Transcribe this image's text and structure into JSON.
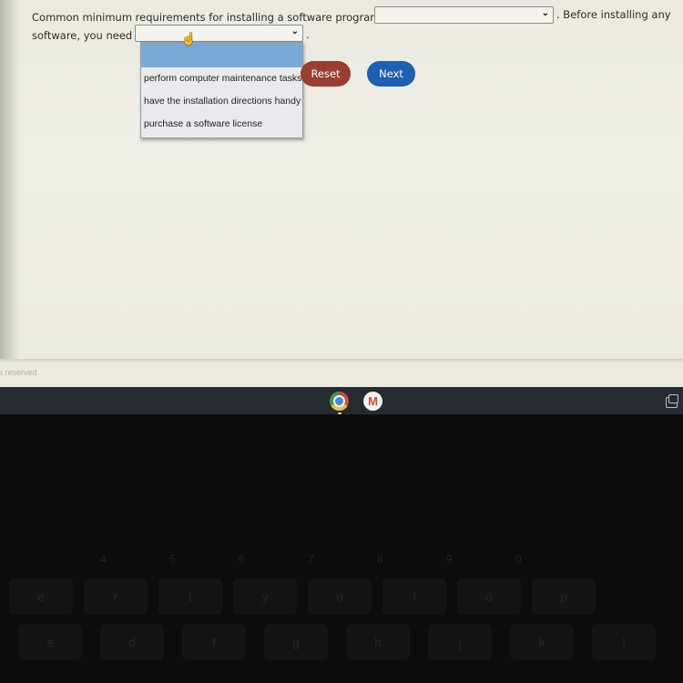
{
  "question": {
    "line1_before": "Common minimum requirements for installing a software program include",
    "line1_after": ". Before installing any",
    "line2_before": "software, you need to",
    "line2_after": "."
  },
  "select1": {
    "value": "",
    "open": false
  },
  "select2": {
    "value": "",
    "open": true,
    "options": [
      "",
      "perform computer maintenance tasks",
      "have the installation directions handy",
      "purchase a software license"
    ]
  },
  "buttons": {
    "reset_label": "Reset",
    "next_label": "Next"
  },
  "footer": {
    "text": "ts reserved."
  },
  "shelf": {
    "apps": [
      {
        "name": "chrome-icon",
        "running": true
      },
      {
        "name": "gmail-icon",
        "glyph": "M",
        "running": false
      }
    ],
    "overview_icon": "overview-icon"
  },
  "colors": {
    "reset": "#9a3e30",
    "next": "#1c5fb3",
    "dropdown_highlight": "#79a9d6",
    "shelf": "#262a31"
  },
  "keyboard": {
    "row_numbers": [
      "4",
      "5",
      "6",
      "7",
      "8",
      "9",
      "0"
    ],
    "row_top": [
      "e",
      "r",
      "t",
      "y",
      "u",
      "i",
      "o",
      "p"
    ],
    "row_home": [
      "s",
      "d",
      "f",
      "g",
      "h",
      "j",
      "k",
      "l"
    ]
  }
}
